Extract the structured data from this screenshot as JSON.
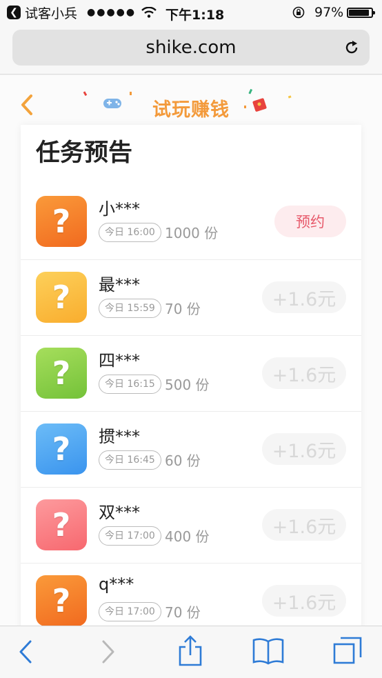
{
  "status_bar": {
    "back_app_label": "试客小兵",
    "signal": "●●●●●",
    "time": "下午1:18",
    "battery": "97%"
  },
  "browser": {
    "url": "shike.com"
  },
  "header": {
    "title": "试玩赚钱"
  },
  "section": {
    "heading": "任务预告"
  },
  "tasks": [
    {
      "name": "小***",
      "time": "今日 16:00",
      "count": "1000 份",
      "action": "预约",
      "color": "#f6822a"
    },
    {
      "name": "最***",
      "time": "今日 15:59",
      "count": "70 份",
      "action": "+1.6元",
      "color": "#fbbd3f"
    },
    {
      "name": "四***",
      "time": "今日 16:15",
      "count": "500 份",
      "action": "+1.6元",
      "color": "#8fd24a"
    },
    {
      "name": "掼***",
      "time": "今日 16:45",
      "count": "60 份",
      "action": "+1.6元",
      "color": "#55aaf3"
    },
    {
      "name": "双***",
      "time": "今日 17:00",
      "count": "400 份",
      "action": "+1.6元",
      "color": "#fb7d82"
    },
    {
      "name": "q***",
      "time": "今日 17:00",
      "count": "70 份",
      "action": "+1.6元",
      "color": "#f6822a"
    }
  ]
}
